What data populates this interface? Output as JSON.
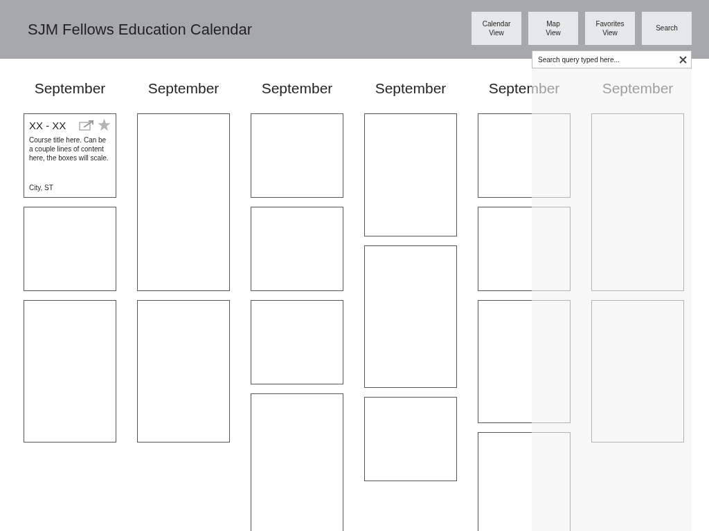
{
  "header": {
    "title": "SJM Fellows Education Calendar"
  },
  "nav_buttons": [
    {
      "label": "Calendar\nView"
    },
    {
      "label": "Map\nView"
    },
    {
      "label": "Favorites\nView"
    },
    {
      "label": "Search"
    }
  ],
  "search": {
    "value": "Search query typed here..."
  },
  "columns": [
    {
      "month": "September",
      "cards": [
        {
          "kind": "course",
          "dates": "XX - XX",
          "title": "Course title here. Can be a couple lines of content here, the boxes will scale.",
          "location": "City, ST",
          "favorite": false
        },
        {
          "kind": "empty"
        },
        {
          "kind": "empty"
        }
      ]
    },
    {
      "month": "September",
      "cards": [
        {
          "kind": "empty"
        },
        {
          "kind": "empty"
        }
      ]
    },
    {
      "month": "September",
      "cards": [
        {
          "kind": "empty"
        },
        {
          "kind": "empty"
        },
        {
          "kind": "empty"
        },
        {
          "kind": "empty"
        }
      ]
    },
    {
      "month": "September",
      "cards": [
        {
          "kind": "empty"
        },
        {
          "kind": "empty"
        },
        {
          "kind": "empty"
        }
      ]
    },
    {
      "month": "September",
      "cards": [
        {
          "kind": "empty"
        },
        {
          "kind": "empty"
        },
        {
          "kind": "empty"
        },
        {
          "kind": "empty"
        }
      ]
    },
    {
      "month": "September",
      "cards": [
        {
          "kind": "empty"
        },
        {
          "kind": "empty"
        }
      ]
    }
  ]
}
